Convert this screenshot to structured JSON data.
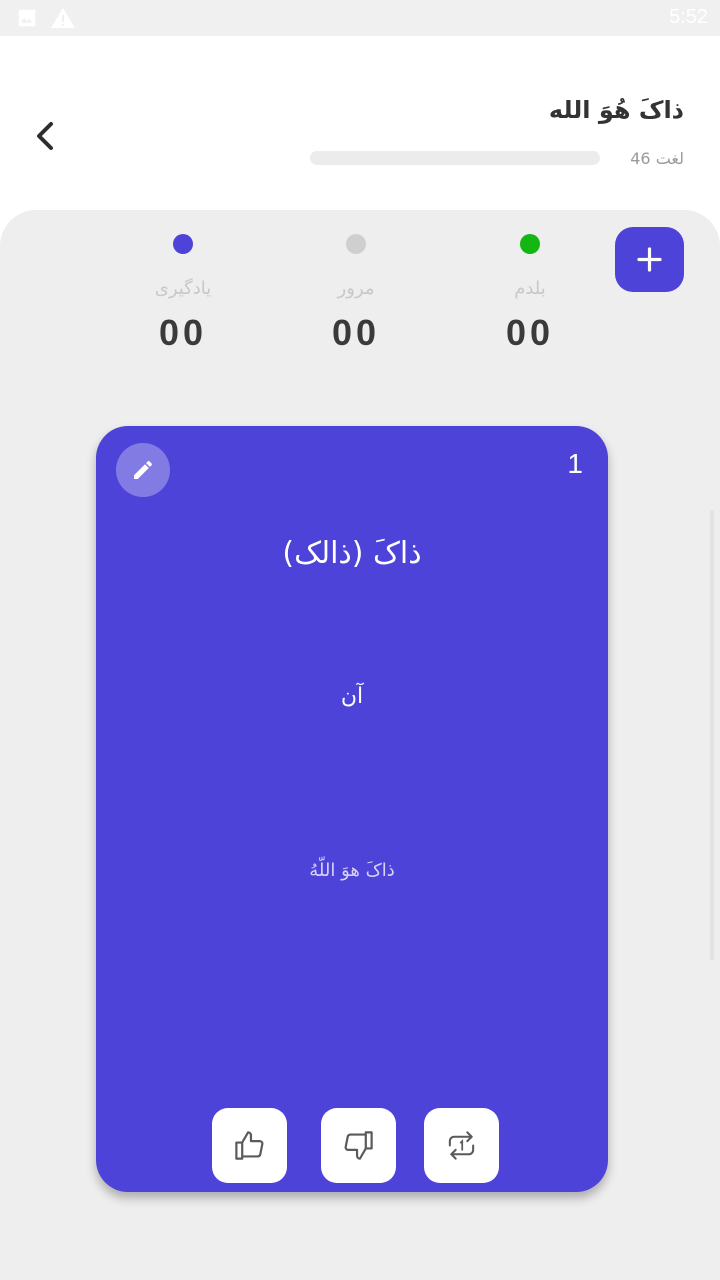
{
  "status_bar": {
    "time": "5:52",
    "icons": [
      "image-icon",
      "warning-icon"
    ]
  },
  "header": {
    "back_icon": "chevron-left-icon",
    "title": "ذاکَ هُوَ الله",
    "word_count": "46",
    "word_count_label": "لغت",
    "progress": 0
  },
  "stats": [
    {
      "label": "بلدم",
      "value": "00",
      "color": "#13b613"
    },
    {
      "label": "مرور",
      "value": "00",
      "color": "#cfcfcf"
    },
    {
      "label": "یادگیری",
      "value": "00",
      "color": "#4e43d9"
    }
  ],
  "add_button_icon": "plus-icon",
  "card": {
    "index": "1",
    "word": "ذاکَ (ذالک)",
    "meaning": "آن",
    "source": "ذاکَ هوَ اللّهُ",
    "edit_icon": "pencil-icon",
    "actions": [
      "thumbs-up-icon",
      "thumbs-down-icon",
      "repeat-icon"
    ]
  },
  "colors": {
    "accent": "#4e43d9",
    "known": "#13b613",
    "review": "#cfcfcf"
  }
}
